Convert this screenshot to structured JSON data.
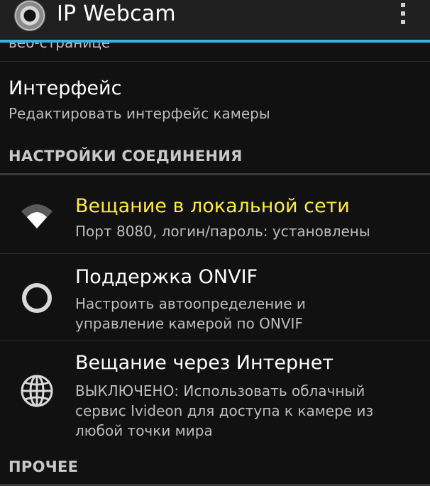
{
  "action_bar": {
    "title": "IP Webcam",
    "logo_icon": "webcam-logo-icon",
    "overflow_icon": "overflow-menu-icon"
  },
  "colors": {
    "accent": "#33b5e5",
    "highlight_title": "#ffeb3b",
    "background": "#111111"
  },
  "scrolled_item": {
    "summary_fragment": "веб-странице"
  },
  "interface_pref": {
    "title": "Интерфейс",
    "summary": "Редактировать интерфейс камеры"
  },
  "connection_section": {
    "header": "НАСТРОЙКИ СОЕДИНЕНИЯ",
    "items": [
      {
        "icon": "wifi-icon",
        "title": "Вещание в локальной сети",
        "summary": "Порт 8080, логин/пароль: установлены",
        "highlighted": true
      },
      {
        "icon": "circle-icon",
        "title": "Поддержка ONVIF",
        "summary": [
          "Настроить автоопределение и",
          "управление камерой по ONVIF"
        ]
      },
      {
        "icon": "globe-icon",
        "title": "Вещание через Интернет",
        "summary": [
          "ВЫКЛЮЧЕНО: Использовать облачный",
          "сервис Ivideon для доступа к камере из",
          "любой точки мира"
        ]
      }
    ]
  },
  "other_section": {
    "header": "ПРОЧЕЕ"
  }
}
